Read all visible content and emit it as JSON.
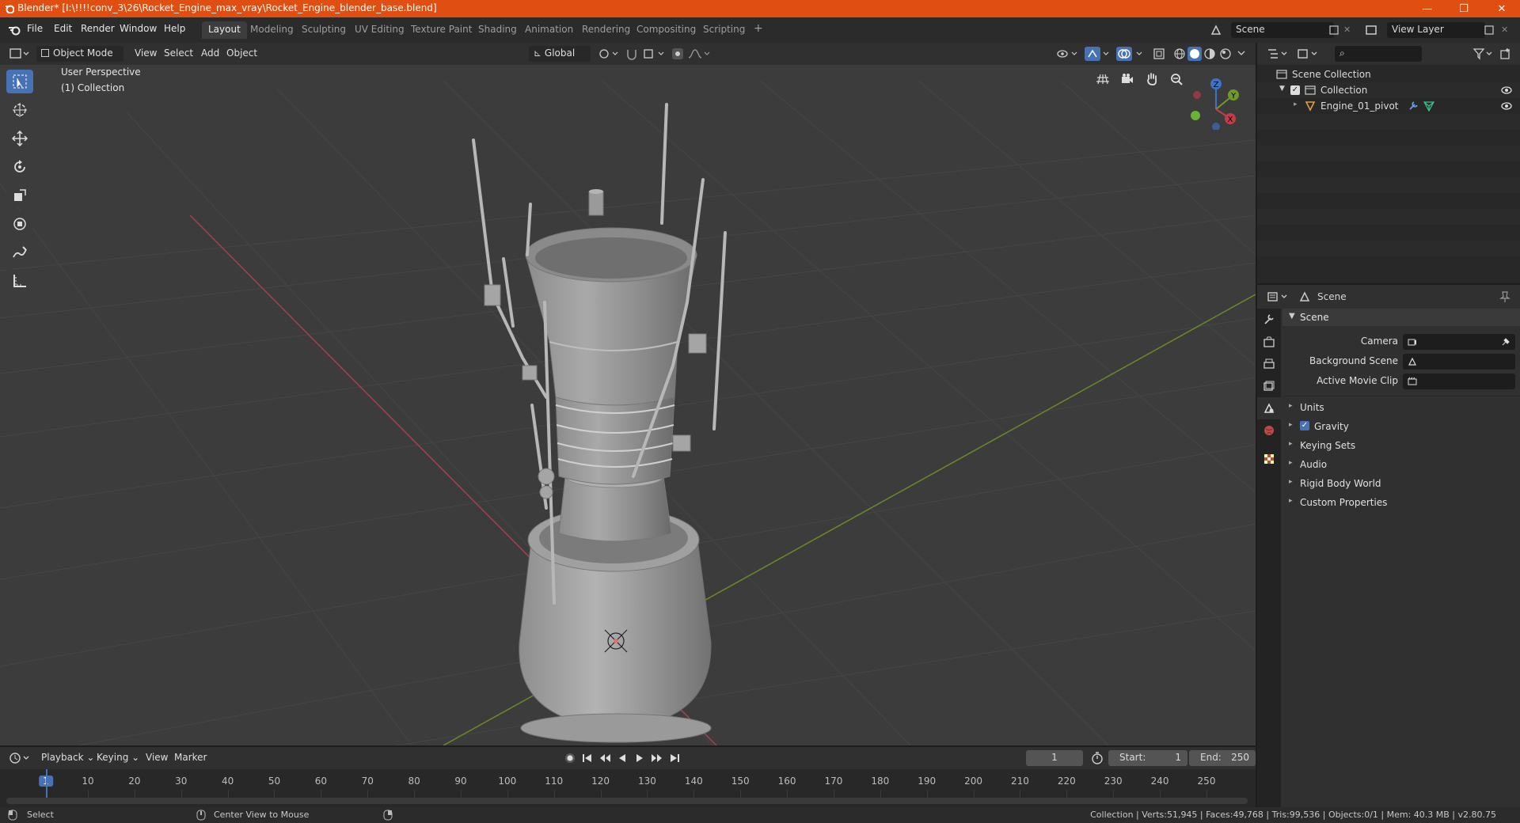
{
  "app": {
    "window_title": "Blender* [I:\\!!!!conv_3\\26\\Rocket_Engine_max_vray\\Rocket_Engine_blender_base.blend]",
    "minimize": "—",
    "maximize": "❐",
    "close": "✕"
  },
  "menubar": {
    "menus": [
      "File",
      "Edit",
      "Render",
      "Window",
      "Help"
    ],
    "workspaces": [
      "Layout",
      "Modeling",
      "Sculpting",
      "UV Editing",
      "Texture Paint",
      "Shading",
      "Animation",
      "Rendering",
      "Compositing",
      "Scripting"
    ],
    "active_workspace": "Layout",
    "add_workspace": "+",
    "scene_name": "Scene",
    "view_layer": "View Layer"
  },
  "viewport_header": {
    "mode": "Object Mode",
    "menus": [
      "View",
      "Select",
      "Add",
      "Object"
    ],
    "orientation": "Global"
  },
  "viewport": {
    "perspective_label": "User Perspective",
    "collection_label": "(1) Collection",
    "gizmo": {
      "z": "Z",
      "y": "Y",
      "x": "X"
    },
    "colors": {
      "x_axis": "#c24a5a",
      "y_axis": "#7a9a2a",
      "background": "#3c3c3c",
      "active_tool": "#4772b3"
    }
  },
  "timeline": {
    "menus": [
      "Playback",
      "Keying",
      "View",
      "Marker"
    ],
    "current_frame": "1",
    "start_label": "Start:",
    "start": "1",
    "end_label": "End:",
    "end": "250",
    "ticks": [
      "1",
      "10",
      "20",
      "30",
      "40",
      "50",
      "60",
      "70",
      "80",
      "90",
      "100",
      "110",
      "120",
      "130",
      "140",
      "150",
      "160",
      "170",
      "180",
      "190",
      "200",
      "210",
      "220",
      "230",
      "240",
      "250"
    ]
  },
  "statusbar": {
    "left_action": "Select",
    "middle_action": "Center View to Mouse",
    "stats": "Collection | Verts:51,945 | Faces:49,768 | Tris:99,536 | Objects:0/1 | Mem: 40.3 MB | v2.80.75"
  },
  "outliner": {
    "root": "Scene Collection",
    "collection": "Collection",
    "object": "Engine_01_pivot"
  },
  "properties": {
    "header_title": "Scene",
    "panel_title": "Scene",
    "camera_label": "Camera",
    "background_scene_label": "Background Scene",
    "active_movie_clip_label": "Active Movie Clip",
    "sections": [
      "Units",
      "Gravity",
      "Keying Sets",
      "Audio",
      "Rigid Body World",
      "Custom Properties"
    ],
    "gravity_checked": true
  }
}
